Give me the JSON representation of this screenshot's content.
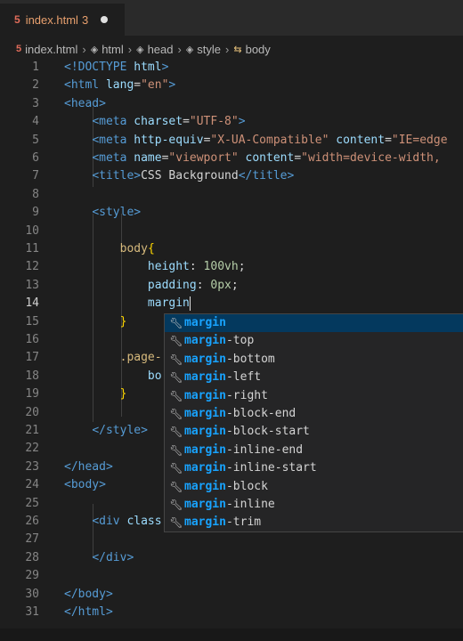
{
  "tab": {
    "file_icon": "html5-file-icon",
    "name": "index.html",
    "problem_count": "3",
    "modified": true
  },
  "breadcrumb": [
    {
      "icon": "html5-file-icon",
      "label": "index.html"
    },
    {
      "icon": "cube-icon",
      "label": "html"
    },
    {
      "icon": "cube-icon",
      "label": "head"
    },
    {
      "icon": "cube-icon",
      "label": "style"
    },
    {
      "icon": "body-tag-icon",
      "label": "body"
    }
  ],
  "editor": {
    "active_line": "14",
    "lines": [
      {
        "n": "1",
        "tokens": [
          [
            "tag",
            "<!DOCTYPE "
          ],
          [
            "attr",
            "html"
          ],
          [
            "tag",
            ">"
          ]
        ]
      },
      {
        "n": "2",
        "tokens": [
          [
            "tag",
            "<html "
          ],
          [
            "attr",
            "lang"
          ],
          [
            "txt",
            "="
          ],
          [
            "str",
            "\"en\""
          ],
          [
            "tag",
            ">"
          ]
        ]
      },
      {
        "n": "3",
        "tokens": [
          [
            "tag",
            "<head>"
          ]
        ]
      },
      {
        "n": "4",
        "tokens": [
          [
            "txt",
            "    "
          ],
          [
            "tag",
            "<meta "
          ],
          [
            "attr",
            "charset"
          ],
          [
            "txt",
            "="
          ],
          [
            "str",
            "\"UTF-8\""
          ],
          [
            "tag",
            ">"
          ]
        ]
      },
      {
        "n": "5",
        "tokens": [
          [
            "txt",
            "    "
          ],
          [
            "tag",
            "<meta "
          ],
          [
            "attr",
            "http-equiv"
          ],
          [
            "txt",
            "="
          ],
          [
            "str",
            "\"X-UA-Compatible\""
          ],
          [
            "txt",
            " "
          ],
          [
            "attr",
            "content"
          ],
          [
            "txt",
            "="
          ],
          [
            "str",
            "\"IE=edge"
          ]
        ]
      },
      {
        "n": "6",
        "tokens": [
          [
            "txt",
            "    "
          ],
          [
            "tag",
            "<meta "
          ],
          [
            "attr",
            "name"
          ],
          [
            "txt",
            "="
          ],
          [
            "str",
            "\"viewport\""
          ],
          [
            "txt",
            " "
          ],
          [
            "attr",
            "content"
          ],
          [
            "txt",
            "="
          ],
          [
            "str",
            "\"width=device-width,"
          ]
        ]
      },
      {
        "n": "7",
        "tokens": [
          [
            "txt",
            "    "
          ],
          [
            "tag",
            "<title>"
          ],
          [
            "txt",
            "CSS Background"
          ],
          [
            "tag",
            "</title>"
          ]
        ]
      },
      {
        "n": "8",
        "tokens": []
      },
      {
        "n": "9",
        "tokens": [
          [
            "txt",
            "    "
          ],
          [
            "tag",
            "<style>"
          ]
        ]
      },
      {
        "n": "10",
        "tokens": []
      },
      {
        "n": "11",
        "tokens": [
          [
            "txt",
            "        "
          ],
          [
            "sel",
            "body"
          ],
          [
            "brk",
            "{"
          ]
        ]
      },
      {
        "n": "12",
        "tokens": [
          [
            "txt",
            "            "
          ],
          [
            "prop",
            "height"
          ],
          [
            "txt",
            ": "
          ],
          [
            "num",
            "100vh"
          ],
          [
            "txt",
            ";"
          ]
        ]
      },
      {
        "n": "13",
        "tokens": [
          [
            "txt",
            "            "
          ],
          [
            "prop",
            "padding"
          ],
          [
            "txt",
            ": "
          ],
          [
            "num",
            "0px"
          ],
          [
            "txt",
            ";"
          ]
        ]
      },
      {
        "n": "14",
        "tokens": [
          [
            "txt",
            "            "
          ],
          [
            "prop",
            "margin"
          ]
        ],
        "cursor": true
      },
      {
        "n": "15",
        "tokens": [
          [
            "txt",
            "        "
          ],
          [
            "brk",
            "}"
          ]
        ]
      },
      {
        "n": "16",
        "tokens": []
      },
      {
        "n": "17",
        "tokens": [
          [
            "txt",
            "        "
          ],
          [
            "sel",
            ".page-"
          ]
        ]
      },
      {
        "n": "18",
        "tokens": [
          [
            "txt",
            "            "
          ],
          [
            "prop",
            "bo"
          ]
        ]
      },
      {
        "n": "19",
        "tokens": [
          [
            "txt",
            "        "
          ],
          [
            "brk",
            "}"
          ]
        ]
      },
      {
        "n": "20",
        "tokens": []
      },
      {
        "n": "21",
        "tokens": [
          [
            "txt",
            "    "
          ],
          [
            "tag",
            "</style>"
          ]
        ]
      },
      {
        "n": "22",
        "tokens": []
      },
      {
        "n": "23",
        "tokens": [
          [
            "tag",
            "</head>"
          ]
        ]
      },
      {
        "n": "24",
        "tokens": [
          [
            "tag",
            "<body>"
          ]
        ]
      },
      {
        "n": "25",
        "tokens": []
      },
      {
        "n": "26",
        "tokens": [
          [
            "txt",
            "    "
          ],
          [
            "tag",
            "<div "
          ],
          [
            "attr",
            "class"
          ]
        ]
      },
      {
        "n": "27",
        "tokens": []
      },
      {
        "n": "28",
        "tokens": [
          [
            "txt",
            "    "
          ],
          [
            "tag",
            "</div>"
          ]
        ]
      },
      {
        "n": "29",
        "tokens": []
      },
      {
        "n": "30",
        "tokens": [
          [
            "tag",
            "</body>"
          ]
        ]
      },
      {
        "n": "31",
        "tokens": [
          [
            "tag",
            "</html>"
          ]
        ]
      }
    ]
  },
  "suggest": {
    "typed": "margin",
    "item_icon": "wrench-icon",
    "selected": "margin",
    "items": [
      "margin",
      "margin-top",
      "margin-bottom",
      "margin-left",
      "margin-right",
      "margin-block-end",
      "margin-block-start",
      "margin-inline-end",
      "margin-inline-start",
      "margin-block",
      "margin-inline",
      "margin-trim"
    ]
  },
  "colors": {
    "tag": "#569cd6",
    "attr": "#9cdcfe",
    "string": "#ce9178",
    "selector": "#d7ba7d",
    "number": "#b5cea8",
    "bracket": "#ffd700",
    "match": "#18a3ff",
    "selection": "#04395e",
    "tab_text": "#e8a06e"
  }
}
